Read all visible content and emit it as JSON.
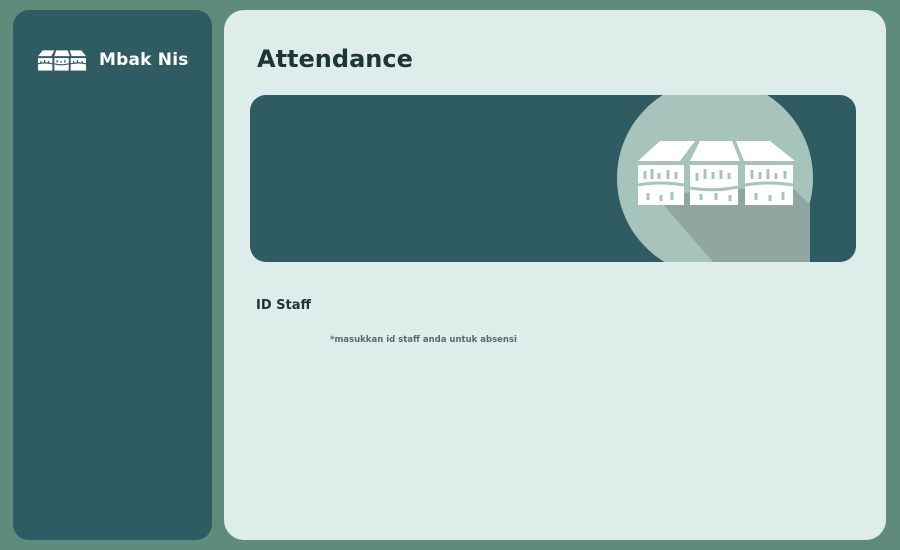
{
  "sidebar": {
    "brand": {
      "name": "Mbak Nis",
      "logo_icon": "market-stall-icon"
    }
  },
  "main": {
    "title": "Attendance",
    "banner": {
      "icon": "market-stall-icon"
    },
    "form": {
      "id_label": "ID Staff",
      "id_value": "",
      "id_hint": "*masukkan id staff anda untuk absensi"
    }
  },
  "colors": {
    "page_bg": "#5f8b7b",
    "sidebar_bg": "#2f5c62",
    "main_bg": "#deecea",
    "banner_bg": "#2f5c62",
    "circle": "#a6c4bc",
    "shadow": "#8fa7a0",
    "title_text": "#1c3537"
  }
}
